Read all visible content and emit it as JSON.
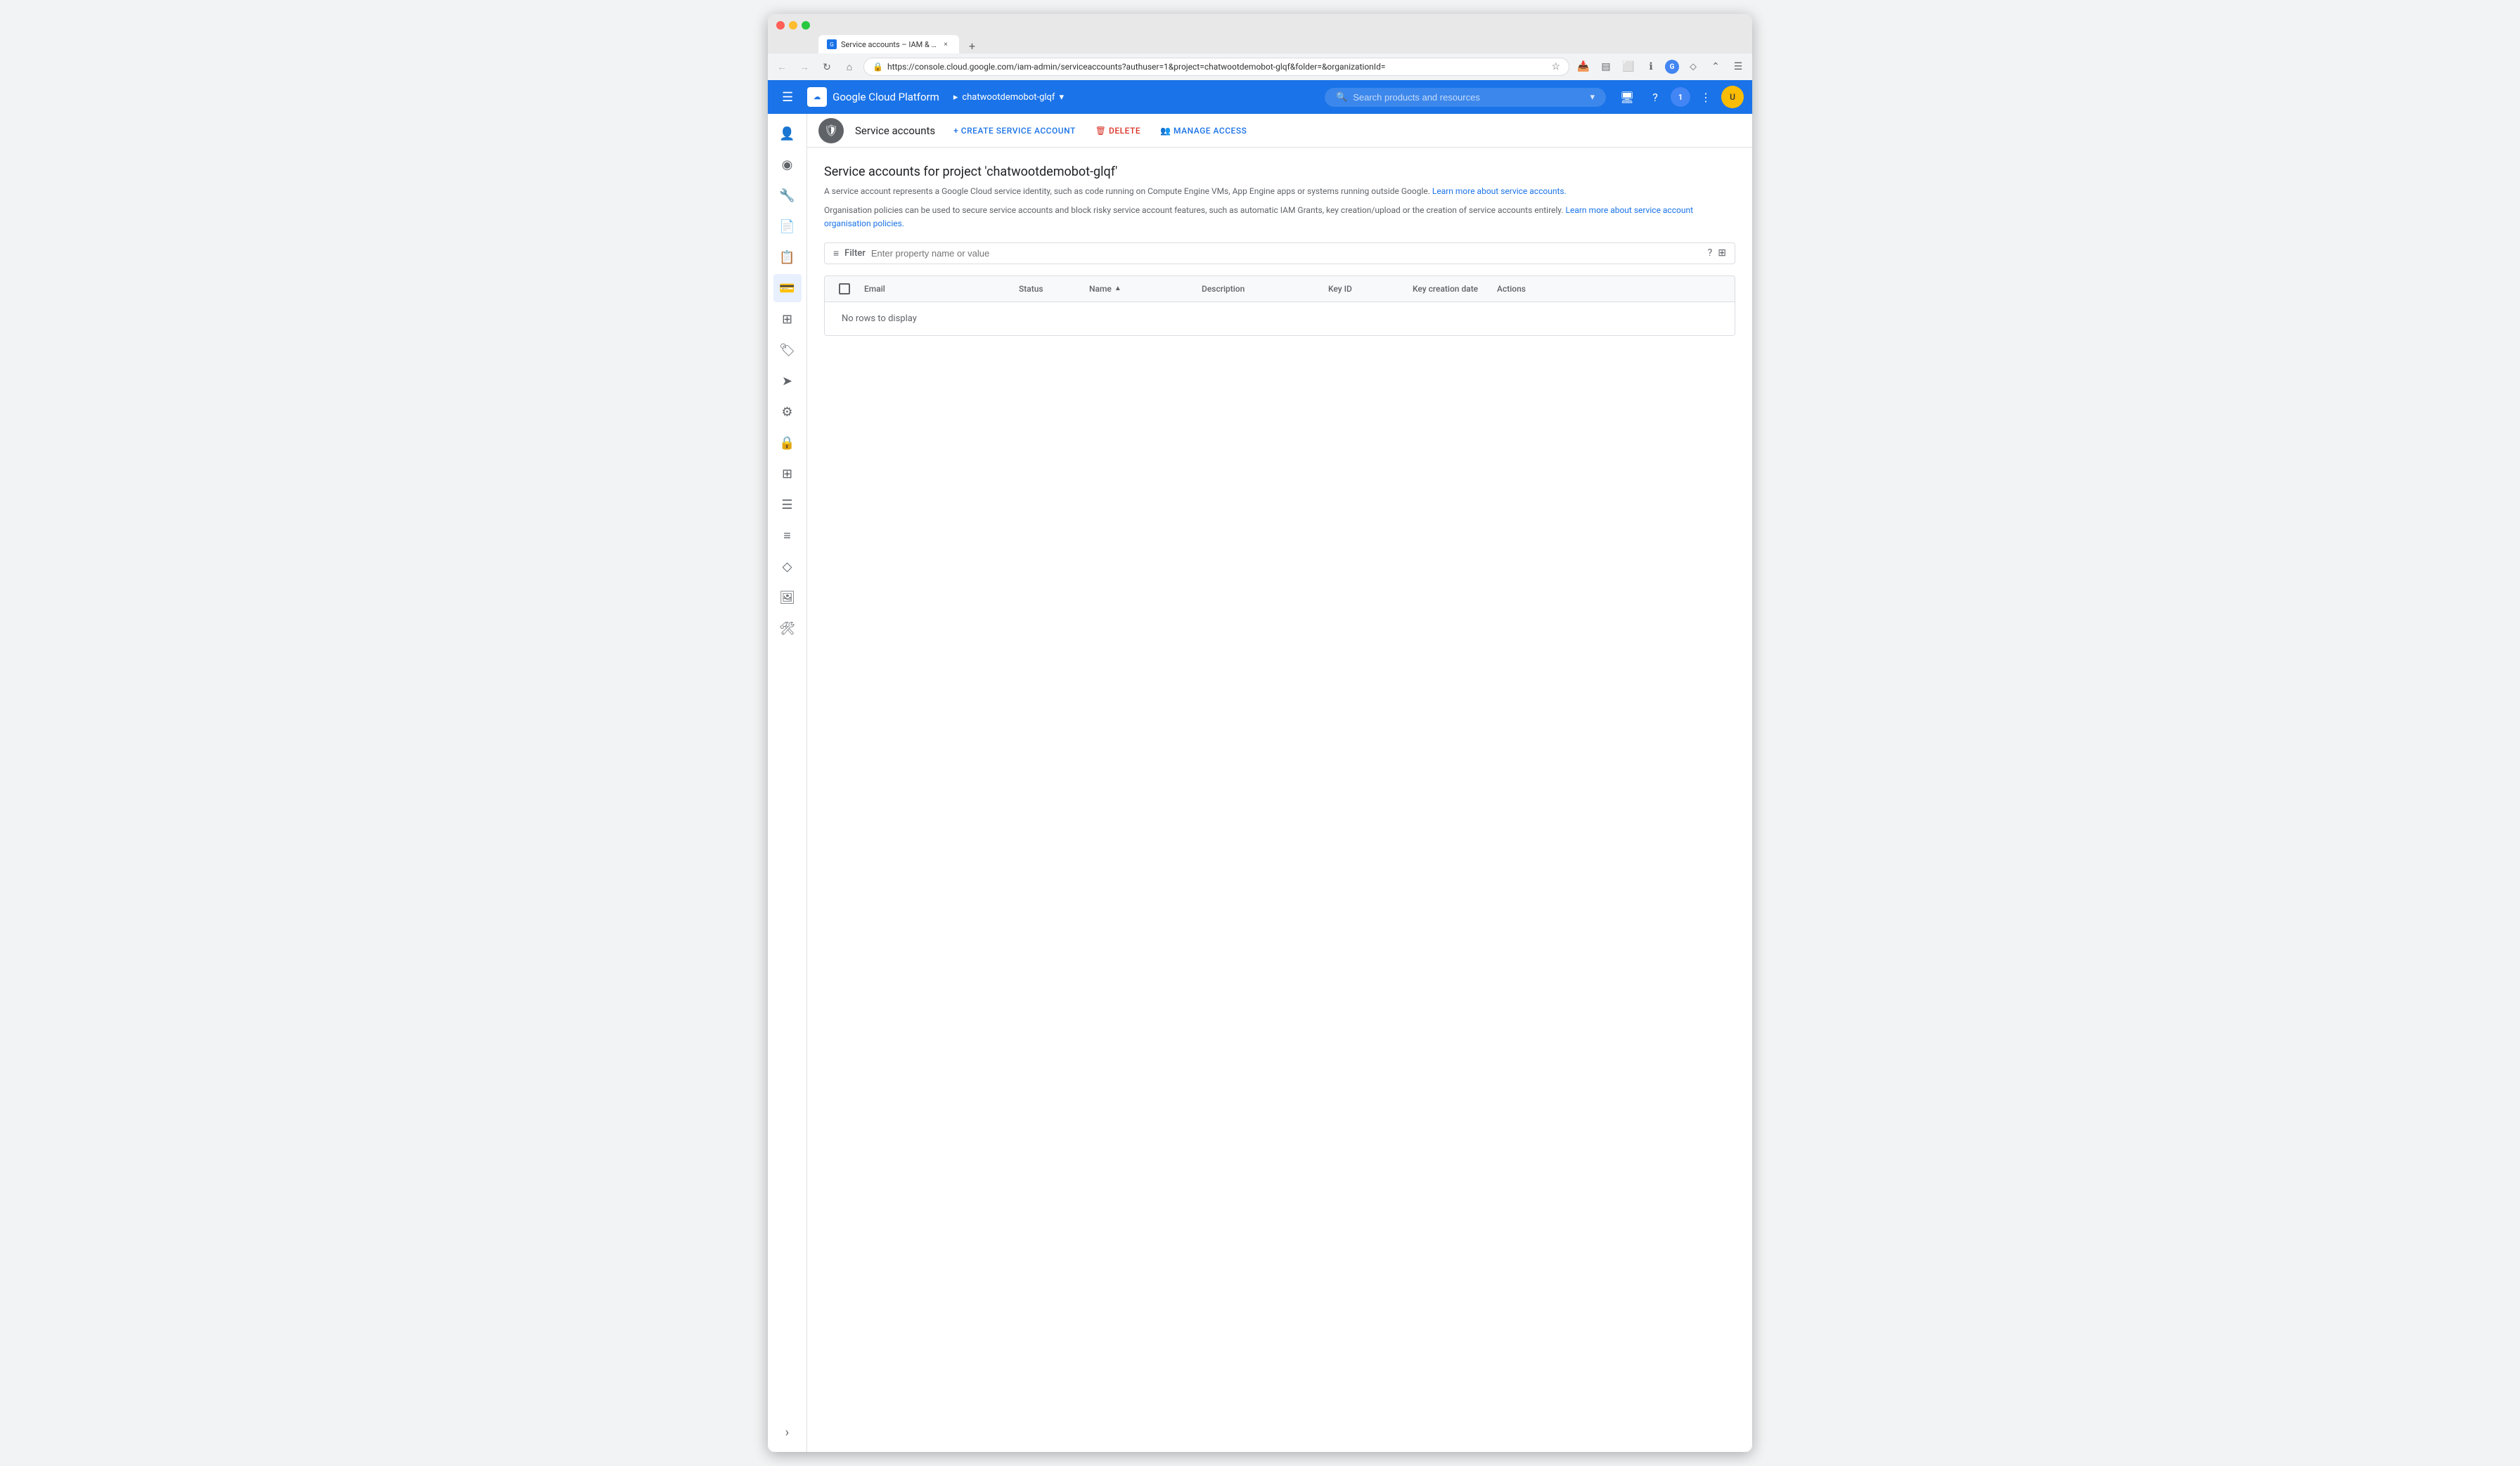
{
  "browser": {
    "tab_title": "Service accounts – IAM & Admi",
    "tab_close": "×",
    "new_tab": "+",
    "url": "https://console.cloud.google.com/iam-admin/serviceaccounts?authuser=1&project=chatwootdemobot-glqf&folder=&organizationId=",
    "nav_back": "←",
    "nav_forward": "→",
    "nav_refresh": "↻",
    "nav_home": "⌂"
  },
  "topnav": {
    "app_name": "Google Cloud Platform",
    "project_name": "chatwootdemobot-glqf",
    "search_placeholder": "Search products and resources",
    "hamburger": "☰"
  },
  "sub_header": {
    "title": "Service accounts",
    "icon": "🛡",
    "actions": {
      "create": "+ CREATE SERVICE ACCOUNT",
      "delete": "🗑 DELETE",
      "manage": "👥 MANAGE ACCESS"
    }
  },
  "page": {
    "title": "Service accounts for project 'chatwootdemobot-glqf'",
    "description_1": "A service account represents a Google Cloud service identity, such as code running on Compute Engine VMs, App Engine apps or systems running outside Google.",
    "link_1": "Learn more about service accounts.",
    "description_2": "Organisation policies can be used to secure service accounts and block risky service account features, such as automatic IAM Grants, key creation/upload or the creation of service accounts entirely.",
    "link_2": "Learn more about service account organisation policies.",
    "filter_placeholder": "Enter property name or value",
    "filter_label": "Filter",
    "no_rows": "No rows to display"
  },
  "table": {
    "columns": [
      {
        "id": "checkbox",
        "label": ""
      },
      {
        "id": "email",
        "label": "Email"
      },
      {
        "id": "status",
        "label": "Status"
      },
      {
        "id": "name",
        "label": "Name",
        "sortable": true
      },
      {
        "id": "description",
        "label": "Description"
      },
      {
        "id": "key_id",
        "label": "Key ID"
      },
      {
        "id": "key_creation_date",
        "label": "Key creation date"
      },
      {
        "id": "actions",
        "label": "Actions"
      }
    ],
    "rows": []
  },
  "sidebar": {
    "icons": [
      {
        "name": "person-icon",
        "symbol": "👤"
      },
      {
        "name": "identity-icon",
        "symbol": "🔵"
      },
      {
        "name": "wrench-icon",
        "symbol": "🔧"
      },
      {
        "name": "document-icon",
        "symbol": "📄"
      },
      {
        "name": "audit-icon",
        "symbol": "📋"
      },
      {
        "name": "service-accounts-icon",
        "symbol": "💳",
        "active": true
      },
      {
        "name": "workload-icon",
        "symbol": "⚙"
      },
      {
        "name": "tag-icon",
        "symbol": "🏷"
      },
      {
        "name": "forward-icon",
        "symbol": "➡"
      },
      {
        "name": "settings-icon",
        "symbol": "⚙"
      },
      {
        "name": "security-icon",
        "symbol": "🔒"
      },
      {
        "name": "table-icon",
        "symbol": "⊞"
      },
      {
        "name": "stack-icon",
        "symbol": "📚"
      },
      {
        "name": "text-icon",
        "symbol": "≡"
      },
      {
        "name": "tag2-icon",
        "symbol": "◇"
      },
      {
        "name": "image-icon",
        "symbol": "🖼"
      },
      {
        "name": "tool2-icon",
        "symbol": "🛠"
      }
    ],
    "expand_icon": "›"
  }
}
